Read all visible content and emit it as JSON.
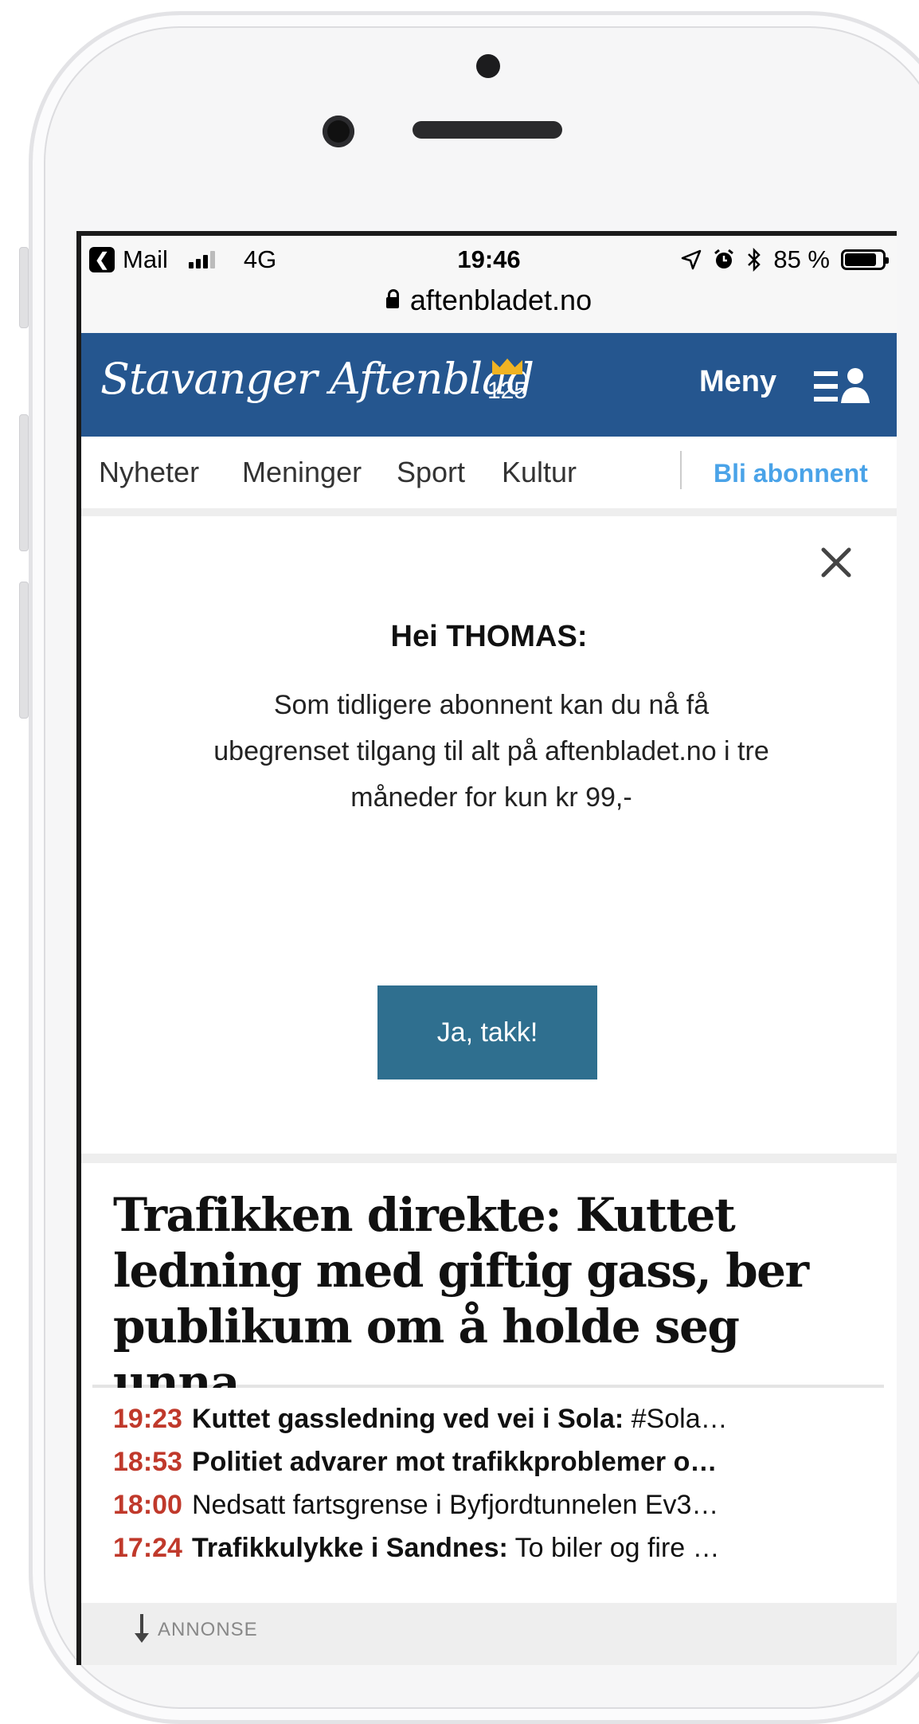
{
  "status_bar": {
    "back_app": "Mail",
    "network": "4G",
    "time": "19:46",
    "battery": "85 %",
    "battery_level": 0.85
  },
  "browser": {
    "url": "aftenbladet.no"
  },
  "header": {
    "logo": "Stavanger Aftenblad",
    "logo_badge": "125",
    "menu_label": "Meny",
    "brand_color": "#25568f"
  },
  "nav": {
    "items": [
      "Nyheter",
      "Meninger",
      "Sport",
      "Kultur"
    ],
    "subscribe": "Bli abonnent"
  },
  "promo": {
    "title": "Hei THOMAS:",
    "body": "Som tidligere abonnent kan du nå få ubegrenset tilgang til alt på aftenbladet.no i tre måneder for kun kr 99,-",
    "button": "Ja, takk!"
  },
  "article": {
    "headline": "Trafikken direkte: Kuttet ledning med giftig gass, ber publikum om å holde seg unna"
  },
  "live_feed": [
    {
      "time": "19:23",
      "bold": "Kuttet gassledning ved vei i Sola:",
      "text": " #Sola…"
    },
    {
      "time": "18:53",
      "bold": "Politiet advarer mot trafikkproblemer o…",
      "text": ""
    },
    {
      "time": "18:00",
      "bold": "",
      "text": "Nedsatt fartsgrense i Byfjordtunnelen Ev3…"
    },
    {
      "time": "17:24",
      "bold": "Trafikkulykke i Sandnes:",
      "text": " To biler og fire …"
    }
  ],
  "ad": {
    "label": "ANNONSE"
  },
  "icons": [
    "back-icon",
    "signal-icon",
    "location-icon",
    "alarm-icon",
    "bluetooth-icon",
    "battery-icon",
    "lock-icon",
    "crown-icon",
    "menu-user-icon",
    "close-icon",
    "arrow-down-icon"
  ]
}
